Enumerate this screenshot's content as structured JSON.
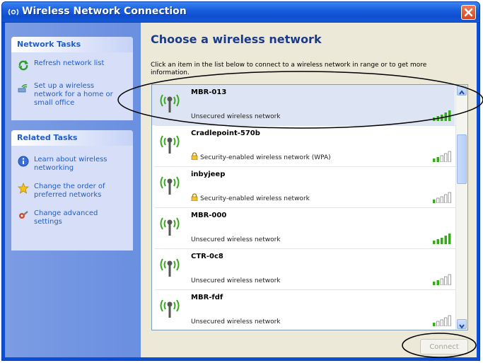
{
  "window": {
    "title": "Wireless Network Connection",
    "title_color": "#ffffff",
    "titlebar_color": "#1a5fe0"
  },
  "network_tasks": {
    "header": "Network Tasks",
    "items": [
      {
        "label": "Refresh network list",
        "icon": "refresh-icon"
      },
      {
        "label": "Set up a wireless network for a home or small office",
        "icon": "setup-network-icon"
      }
    ]
  },
  "related_tasks": {
    "header": "Related Tasks",
    "items": [
      {
        "label": "Learn about wireless networking",
        "icon": "info-icon"
      },
      {
        "label": "Change the order of preferred networks",
        "icon": "star-icon"
      },
      {
        "label": "Change advanced settings",
        "icon": "settings-icon"
      }
    ]
  },
  "main": {
    "heading": "Choose a wireless network",
    "instructions": "Click an item in the list below to connect to a wireless network in range or to get more information."
  },
  "networks": [
    {
      "name": "MBR-013",
      "status": "Unsecured wireless network",
      "secured": false,
      "signal_bars": 5,
      "selected": true
    },
    {
      "name": "Cradlepoint-570b",
      "status": "Security-enabled wireless network (WPA)",
      "secured": true,
      "signal_bars": 2,
      "selected": false
    },
    {
      "name": "inbyjeep",
      "status": "Security-enabled wireless network",
      "secured": true,
      "signal_bars": 1,
      "selected": false
    },
    {
      "name": "MBR-000",
      "status": "Unsecured wireless network",
      "secured": false,
      "signal_bars": 5,
      "selected": false
    },
    {
      "name": "CTR-0c8",
      "status": "Unsecured wireless network",
      "secured": false,
      "signal_bars": 2,
      "selected": false
    },
    {
      "name": "MBR-fdf",
      "status": "Unsecured wireless network",
      "secured": false,
      "signal_bars": 1,
      "selected": false
    }
  ],
  "connect_button": {
    "label": "Connect",
    "enabled": false
  },
  "colors": {
    "accent": "#215dc6",
    "signal_green": "#3aa81f",
    "signal_gray": "#c8c8c8",
    "close_red": "#d8461d",
    "selected_row": "#dde5f5"
  }
}
